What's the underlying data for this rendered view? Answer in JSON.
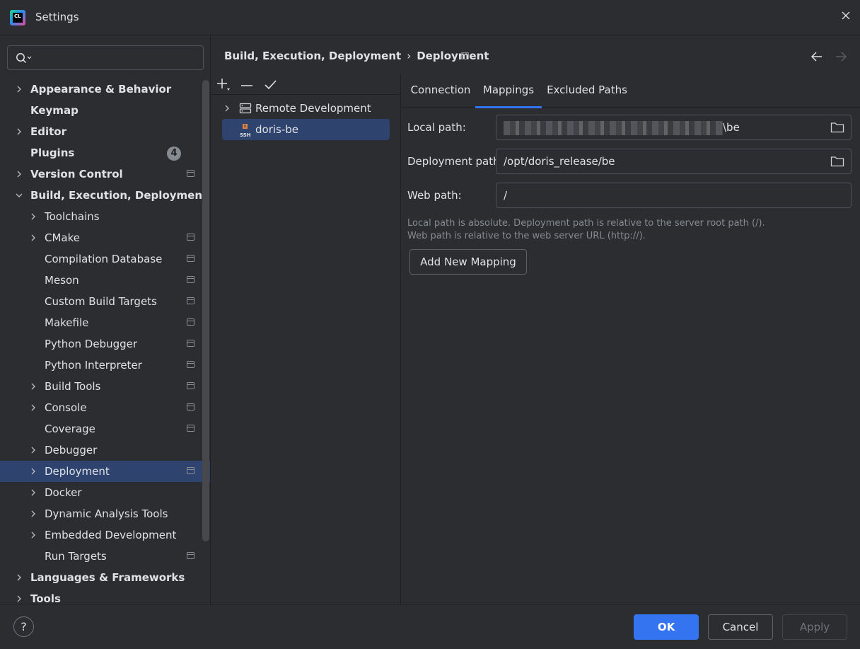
{
  "window": {
    "title": "Settings",
    "logo_text": "CL"
  },
  "search": {
    "placeholder": ""
  },
  "sidebar": {
    "items": [
      {
        "label": "Appearance & Behavior",
        "level": 0,
        "expandable": true,
        "expanded": false,
        "bold": true,
        "project": false
      },
      {
        "label": "Keymap",
        "level": 0,
        "expandable": false,
        "bold": true,
        "project": false
      },
      {
        "label": "Editor",
        "level": 0,
        "expandable": true,
        "expanded": false,
        "bold": true,
        "project": false
      },
      {
        "label": "Plugins",
        "level": 0,
        "expandable": false,
        "bold": true,
        "project": false,
        "badge": "4"
      },
      {
        "label": "Version Control",
        "level": 0,
        "expandable": true,
        "expanded": false,
        "bold": true,
        "project": true
      },
      {
        "label": "Build, Execution, Deployment",
        "level": 0,
        "expandable": true,
        "expanded": true,
        "bold": true,
        "project": false
      },
      {
        "label": "Toolchains",
        "level": 1,
        "expandable": true,
        "expanded": false,
        "project": false
      },
      {
        "label": "CMake",
        "level": 1,
        "expandable": true,
        "expanded": false,
        "project": true
      },
      {
        "label": "Compilation Database",
        "level": 1,
        "expandable": false,
        "project": true
      },
      {
        "label": "Meson",
        "level": 1,
        "expandable": false,
        "project": true
      },
      {
        "label": "Custom Build Targets",
        "level": 1,
        "expandable": false,
        "project": true
      },
      {
        "label": "Makefile",
        "level": 1,
        "expandable": false,
        "project": true
      },
      {
        "label": "Python Debugger",
        "level": 1,
        "expandable": false,
        "project": true
      },
      {
        "label": "Python Interpreter",
        "level": 1,
        "expandable": false,
        "project": true
      },
      {
        "label": "Build Tools",
        "level": 1,
        "expandable": true,
        "expanded": false,
        "project": true
      },
      {
        "label": "Console",
        "level": 1,
        "expandable": true,
        "expanded": false,
        "project": true
      },
      {
        "label": "Coverage",
        "level": 1,
        "expandable": false,
        "project": true
      },
      {
        "label": "Debugger",
        "level": 1,
        "expandable": true,
        "expanded": false,
        "project": false
      },
      {
        "label": "Deployment",
        "level": 1,
        "expandable": true,
        "expanded": false,
        "project": true,
        "selected": true
      },
      {
        "label": "Docker",
        "level": 1,
        "expandable": true,
        "expanded": false,
        "project": false
      },
      {
        "label": "Dynamic Analysis Tools",
        "level": 1,
        "expandable": true,
        "expanded": false,
        "project": false
      },
      {
        "label": "Embedded Development",
        "level": 1,
        "expandable": true,
        "expanded": false,
        "project": false
      },
      {
        "label": "Run Targets",
        "level": 1,
        "expandable": false,
        "project": true
      },
      {
        "label": "Languages & Frameworks",
        "level": 0,
        "expandable": true,
        "expanded": false,
        "bold": true,
        "project": false
      },
      {
        "label": "Tools",
        "level": 0,
        "expandable": true,
        "expanded": false,
        "bold": true,
        "project": false
      }
    ]
  },
  "header": {
    "breadcrumb_parent": "Build, Execution, Deployment",
    "breadcrumb_separator": "›",
    "breadcrumb_current": "Deployment"
  },
  "servers": {
    "group_label": "Remote Development",
    "selected_label": "doris-be",
    "selected_icon_text": "SSH"
  },
  "tabs": [
    "Connection",
    "Mappings",
    "Excluded Paths"
  ],
  "active_tab": "Mappings",
  "mappings": {
    "local_path_label": "Local path:",
    "local_path_value_suffix": "\\be",
    "deployment_path_label": "Deployment path:",
    "deployment_path_value": "/opt/doris_release/be",
    "web_path_label": "Web path:",
    "web_path_value": "/",
    "hint_line1": "Local path is absolute. Deployment path is relative to the server root path (/).",
    "hint_line2": "Web path is relative to the web server URL (http://).",
    "add_button": "Add New Mapping"
  },
  "footer": {
    "help": "?",
    "ok": "OK",
    "cancel": "Cancel",
    "apply": "Apply"
  },
  "colors": {
    "background": "#2b2d30",
    "selection": "#2e436e",
    "accent": "#3574f0",
    "text": "#dfe1e5",
    "muted": "#868a91"
  }
}
